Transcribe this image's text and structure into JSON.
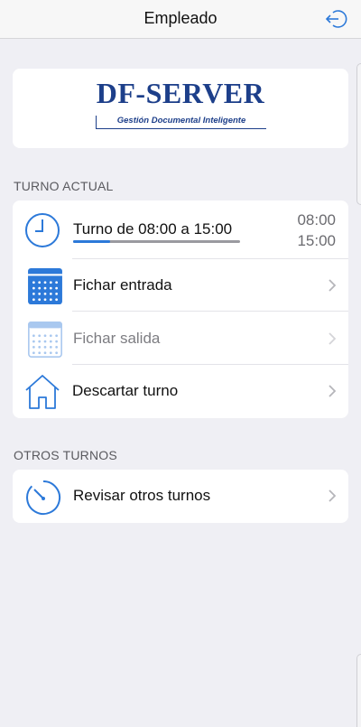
{
  "header": {
    "title": "Empleado",
    "logout_icon": "logout-icon"
  },
  "logo": {
    "main": "DF-SERVER",
    "tagline": "Gestión Documental Inteligente",
    "color": "#1d3f8a"
  },
  "sections": {
    "current": {
      "label": "TURNO ACTUAL"
    },
    "others": {
      "label": "OTROS TURNOS"
    }
  },
  "shift": {
    "title": "Turno de 08:00 a 15:00",
    "start": "08:00",
    "end": "15:00",
    "progress": 0.22
  },
  "actions": [
    {
      "label": "Fichar entrada",
      "icon": "calendar-icon",
      "enabled": true
    },
    {
      "label": "Fichar salida",
      "icon": "calendar-icon",
      "enabled": false
    },
    {
      "label": "Descartar turno",
      "icon": "home-icon",
      "enabled": true
    }
  ],
  "other": {
    "label": "Revisar otros turnos",
    "icon": "timer-icon"
  },
  "colors": {
    "accent": "#2c79d9",
    "background": "#efeff4",
    "disabled": "#7d7d82"
  }
}
